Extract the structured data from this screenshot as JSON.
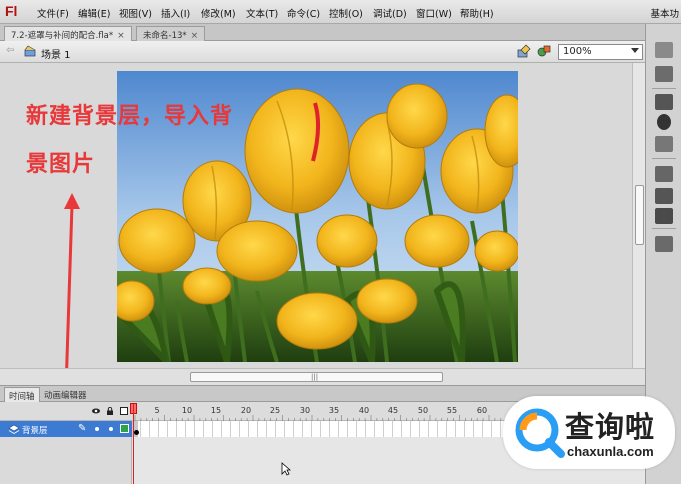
{
  "app": {
    "logo": "Fl",
    "menu": [
      "文件(F)",
      "编辑(E)",
      "视图(V)",
      "插入(I)",
      "修改(M)",
      "文本(T)",
      "命令(C)",
      "控制(O)",
      "调试(D)",
      "窗口(W)",
      "帮助(H)"
    ],
    "workspace_label": "基本功"
  },
  "tabs": [
    {
      "label": "7.2-遮罩与补间的配合.fla*",
      "active": true
    },
    {
      "label": "未命名-13*",
      "active": false
    }
  ],
  "editbar": {
    "back_arrow": "⇦",
    "scene_label": "场景 1",
    "zoom": "100%"
  },
  "annotation": {
    "line1": "新建背景层，导入背",
    "line2": "景图片",
    "color": "#e8383a"
  },
  "timeline": {
    "tabs": [
      "时间轴",
      "动画编辑器"
    ],
    "frame_numbers": [
      "1",
      "5",
      "10",
      "15",
      "20",
      "25",
      "30",
      "35",
      "40",
      "45",
      "50",
      "55",
      "60"
    ],
    "layer": {
      "name": "背景层"
    },
    "playhead_color": "#e02020"
  },
  "watermark": {
    "title": "查询啦",
    "url": "chaxunla.com"
  },
  "colors": {
    "layer_selected": "#3c7bd1",
    "tulip_yellow": "#f2b51c",
    "sky": "#8fb7e3"
  },
  "icons": [
    "scene-icon",
    "edit-symbol-icon",
    "edit-scene-icon",
    "eye-icon",
    "lock-icon",
    "outline-icon",
    "layer-icon",
    "pencil-icon",
    "cursor-icon",
    "magnifier-icon"
  ]
}
